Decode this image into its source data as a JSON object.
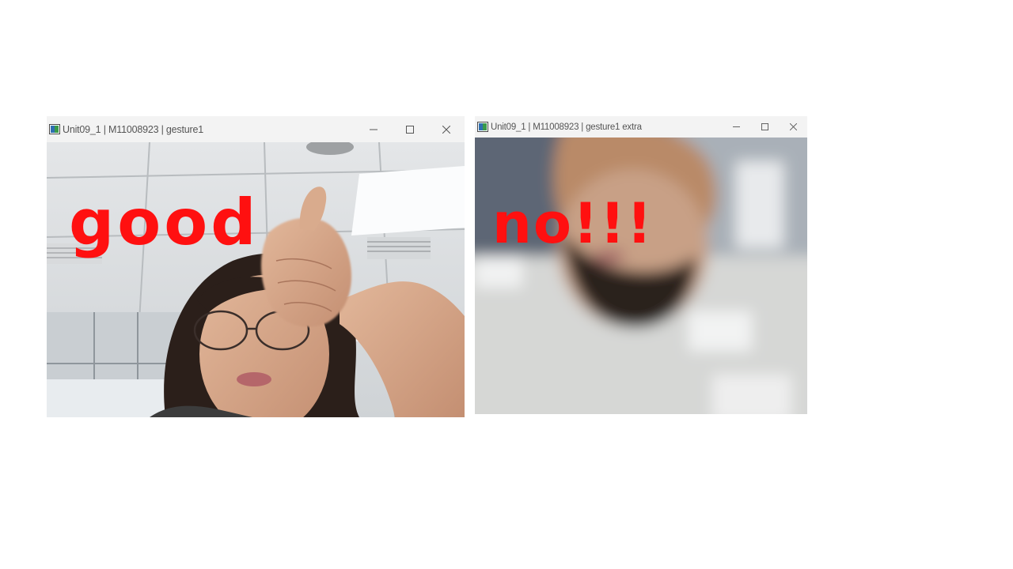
{
  "windows": [
    {
      "title": "Unit09_1 | M11008923 | gesture1",
      "overlay_text": "good",
      "controls": {
        "minimize": "–",
        "maximize": "☐",
        "close": "✕"
      }
    },
    {
      "title": "Unit09_1 | M11008923 | gesture1 extra",
      "overlay_text": "no!!!",
      "controls": {
        "minimize": "–",
        "maximize": "☐",
        "close": "✕"
      }
    }
  ],
  "colors": {
    "overlay_text": "#ff1010",
    "titlebar_bg": "#f3f3f3"
  },
  "icons": [
    "app-window-icon",
    "minimize-icon",
    "maximize-icon",
    "close-icon"
  ]
}
